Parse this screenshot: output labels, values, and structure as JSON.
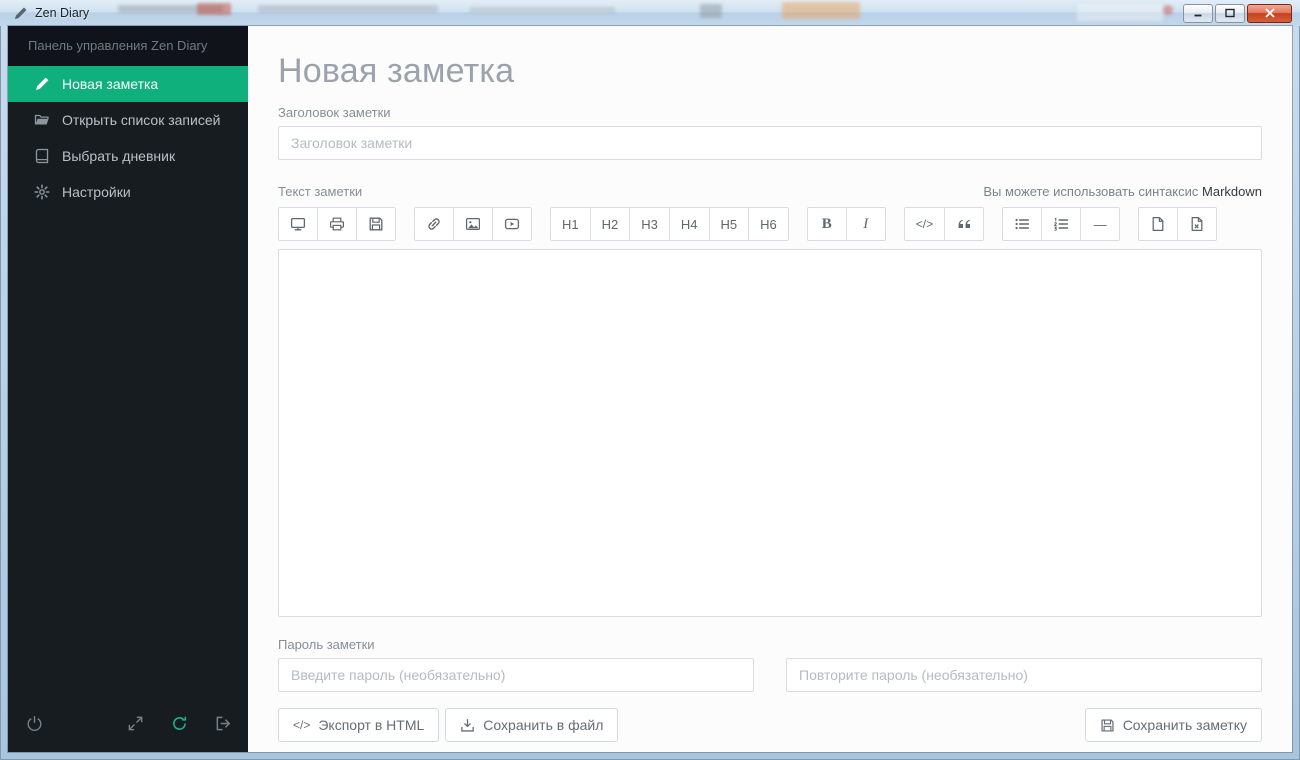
{
  "colors": {
    "accent": "#0fb07c"
  },
  "window": {
    "title": "Zen Diary",
    "icon": "pencil",
    "controls": {
      "minimize": "minimize",
      "maximize": "maximize",
      "close": "close"
    }
  },
  "sidebar": {
    "header": "Панель управления Zen Diary",
    "items": [
      {
        "name": "new-note",
        "label": "Новая заметка",
        "icon": "pencil",
        "active": true
      },
      {
        "name": "open-notes-list",
        "label": "Открыть список записей",
        "icon": "folder-open",
        "active": false
      },
      {
        "name": "choose-diary",
        "label": "Выбрать дневник",
        "icon": "book",
        "active": false
      },
      {
        "name": "settings",
        "label": "Настройки",
        "icon": "gear",
        "active": false
      }
    ],
    "footer": [
      {
        "name": "power",
        "icon": "power"
      },
      {
        "name": "fullscreen",
        "icon": "expand"
      },
      {
        "name": "refresh",
        "icon": "refresh",
        "accent": true
      },
      {
        "name": "exit",
        "icon": "sign-out"
      }
    ]
  },
  "main": {
    "page_title": "Новая заметка",
    "note_title": {
      "label": "Заголовок заметки",
      "placeholder": "Заголовок заметки",
      "value": ""
    },
    "note_text": {
      "label": "Текст заметки",
      "hint": "Вы можете использовать синтаксис",
      "hint_emphasis": "Markdown",
      "value": ""
    },
    "toolbar": [
      {
        "name": "view",
        "buttons": [
          {
            "name": "preview",
            "icon": "monitor"
          },
          {
            "name": "print",
            "icon": "printer"
          },
          {
            "name": "save",
            "icon": "floppy"
          }
        ]
      },
      {
        "name": "insert",
        "buttons": [
          {
            "name": "link",
            "icon": "link"
          },
          {
            "name": "image",
            "icon": "image"
          },
          {
            "name": "youtube",
            "icon": "youtube"
          }
        ]
      },
      {
        "name": "headings",
        "buttons": [
          {
            "name": "h1",
            "text": "H1"
          },
          {
            "name": "h2",
            "text": "H2"
          },
          {
            "name": "h3",
            "text": "H3"
          },
          {
            "name": "h4",
            "text": "H4"
          },
          {
            "name": "h5",
            "text": "H5"
          },
          {
            "name": "h6",
            "text": "H6"
          }
        ]
      },
      {
        "name": "style",
        "buttons": [
          {
            "name": "bold",
            "text": "B",
            "style": "bold"
          },
          {
            "name": "italic",
            "text": "I",
            "style": "italic"
          }
        ]
      },
      {
        "name": "blocks",
        "buttons": [
          {
            "name": "code",
            "text": "</>",
            "style": "code"
          },
          {
            "name": "quote",
            "icon": "quote"
          }
        ]
      },
      {
        "name": "lists",
        "buttons": [
          {
            "name": "bullet-list",
            "icon": "list-ul"
          },
          {
            "name": "numbered-list",
            "icon": "list-ol"
          },
          {
            "name": "horizontal-rule",
            "text": "—"
          }
        ]
      },
      {
        "name": "file",
        "buttons": [
          {
            "name": "new-note",
            "icon": "file-new"
          },
          {
            "name": "clear-note",
            "icon": "file-delete"
          }
        ]
      }
    ],
    "password": {
      "label": "Пароль заметки",
      "first_placeholder": "Введите пароль (необязательно)",
      "repeat_placeholder": "Повторите пароль (необязательно)",
      "first_value": "",
      "repeat_value": ""
    },
    "actions": {
      "export_html": {
        "label": "Экспорт в HTML",
        "icon": "code"
      },
      "save_to_file": {
        "label": "Сохранить в файл",
        "icon": "download"
      },
      "save_note": {
        "label": "Сохранить заметку",
        "icon": "floppy"
      }
    }
  }
}
